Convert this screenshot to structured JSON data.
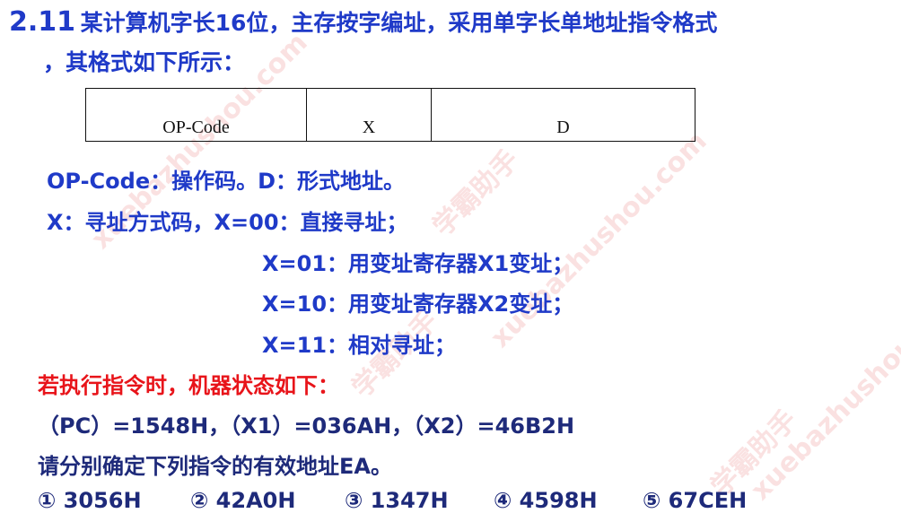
{
  "title": {
    "number": "2.11",
    "line1": "某计算机字长16位，主存按字编址，采用单字长单地址指令格式",
    "line2": "，其格式如下所示："
  },
  "format_table": {
    "fields": [
      "OP-Code",
      "X",
      "D"
    ]
  },
  "definitions": {
    "opcode": "OP-Code：操作码。D：形式地址。",
    "x_intro": "X：寻址方式码，X=00：直接寻址；",
    "x01": "X=01：用变址寄存器X1变址；",
    "x10": "X=10：用变址寄存器X2变址；",
    "x11": "X=11：相对寻址；"
  },
  "machine_state": {
    "heading": "若执行指令时，机器状态如下：",
    "registers": "（PC）=1548H，（X1）=036AH，（X2）=46B2H"
  },
  "question": "请分别确定下列指令的有效地址EA。",
  "instructions": [
    "① 3056H",
    "② 42A0H",
    "③ 1347H",
    "④ 4598H",
    "⑤ 67CEH"
  ],
  "watermarks": [
    "xuebazhushou.com",
    "学霸助手",
    "学霸助手",
    "xuebazhushou.com",
    "学霸助手",
    "xuebazhushou.com"
  ]
}
